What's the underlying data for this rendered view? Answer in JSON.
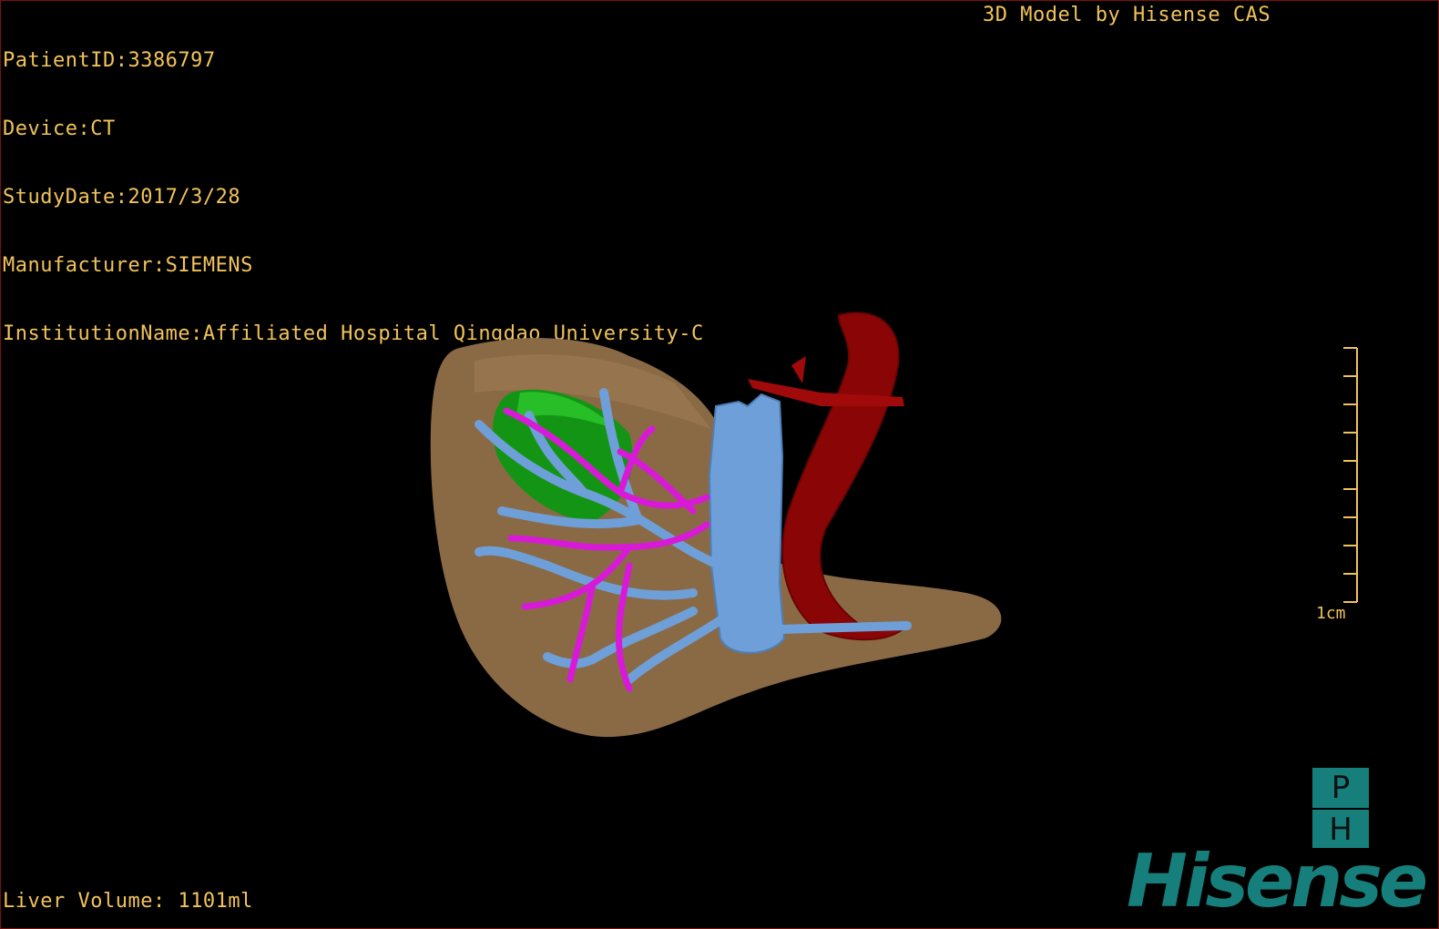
{
  "header": {
    "patient_id": "PatientID:3386797",
    "device": "Device:CT",
    "study_date": "StudyDate:2017/3/28",
    "manufacturer": "Manufacturer:SIEMENS",
    "institution": "InstitutionName:Affiliated Hospital Qingdao University-C"
  },
  "vendor_text": "3D Model by Hisense CAS",
  "footer": {
    "liver_volume": "Liver Volume: 1101ml"
  },
  "scale_bar": {
    "label": "1cm"
  },
  "orientation_cube": {
    "top_face": "P",
    "bottom_face": "H"
  },
  "brand": {
    "logo_text": "Hisense"
  },
  "colors": {
    "overlay_text": "#f2c35a",
    "liver": "#8a6a45",
    "tumor": "#149414",
    "portal_vein": "#6f9fd8",
    "hepatic_vein": "#d81ad8",
    "aorta": "#8a0606",
    "brand": "#167f7b"
  }
}
